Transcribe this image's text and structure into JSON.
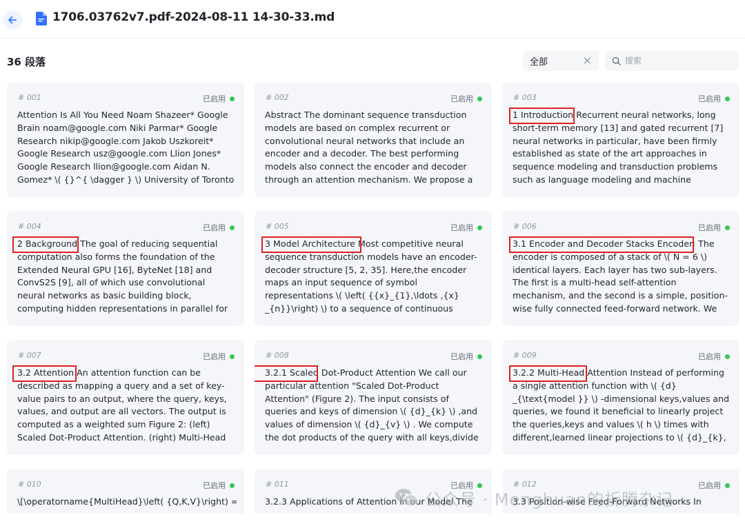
{
  "header": {
    "title": "1706.03762v7.pdf-2024-08-11 14-30-33.md"
  },
  "toolbar": {
    "count_label": "36 段落",
    "filter_label": "全部",
    "search_placeholder": "搜索"
  },
  "cards": [
    {
      "id": "# 001",
      "status": "已启用",
      "lines": [
        "Attention Is All You Need Noam Shazeer* Google",
        "Brain noam@google.com Niki Parmar* Google",
        "Research nikip@google.com Jakob Uszkoreit*",
        "Google Research usz@google.com Llion Jones*",
        "Google Research llion@google.com Aidan N.",
        "Gomez* \\( {}^{ \\dagger } \\) University of Toronto"
      ]
    },
    {
      "id": "# 002",
      "status": "已启用",
      "lines": [
        "Abstract The dominant sequence transduction",
        "models are based on complex recurrent or",
        "convolutional neural networks that include an",
        "encoder and a decoder. The best performing",
        "models also connect the encoder and decoder",
        "through an attention mechanism. We propose a"
      ]
    },
    {
      "id": "# 003",
      "status": "已启用",
      "lines": [
        "1 Introduction Recurrent neural networks, long",
        "short-term memory [13] and gated recurrent [7]",
        "neural networks in particular, have been firmly",
        "established as state of the art approaches in",
        "sequence modeling and transduction problems",
        "such as language modeling and machine"
      ]
    },
    {
      "id": "# 004",
      "status": "已启用",
      "lines": [
        "2 Background The goal of reducing sequential",
        "computation also forms the foundation of the",
        "Extended Neural GPU [16], ByteNet [18] and",
        "ConvS2S [9], all of which use convolutional",
        "neural networks as basic building block,",
        "computing hidden representations in parallel for"
      ]
    },
    {
      "id": "# 005",
      "status": "已启用",
      "lines": [
        "3 Model Architecture Most competitive neural",
        "sequence transduction models have an encoder-",
        "decoder structure [5, 2, 35]. Here,the encoder",
        "maps an input sequence of symbol",
        "representations \\( \\left( {{x}_{1},\\ldots ,{x}",
        "_{n}}\\right) \\) to a sequence of continuous"
      ]
    },
    {
      "id": "# 006",
      "status": "已启用",
      "lines": [
        "3.1 Encoder and Decoder Stacks Encoder: The",
        "encoder is composed of a stack of \\( N = 6 \\)",
        "identical layers. Each layer has two sub-layers.",
        "The first is a multi-head self-attention",
        "mechanism, and the second is a simple, position-",
        "wise fully connected feed-forward network. We"
      ]
    },
    {
      "id": "# 007",
      "status": "已启用",
      "lines": [
        "3.2 Attention An attention function can be",
        "described as mapping a query and a set of key-",
        "value pairs to an output, where the query, keys,",
        "values, and output are all vectors. The output is",
        "computed as a weighted sum Figure 2: (left)",
        "Scaled Dot-Product Attention. (right) Multi-Head"
      ]
    },
    {
      "id": "# 008",
      "status": "已启用",
      "lines": [
        "3.2.1 Scaled Dot-Product Attention We call our",
        "particular attention \"Scaled Dot-Product",
        "Attention\" (Figure 2). The input consists of",
        "queries and keys of dimension \\( {d}_{k} \\) ,and",
        "values of dimension \\( {d}_{v} \\) . We compute",
        "the dot products of the query with all keys,divide"
      ]
    },
    {
      "id": "# 009",
      "status": "已启用",
      "lines": [
        "3.2.2 Multi-Head Attention Instead of performing",
        "a single attention function with \\( {d}",
        "_{\\text{model }} \\) -dimensional keys,values and",
        "queries, we found it beneficial to linearly project",
        "the queries,keys and values \\( h \\) times with",
        "different,learned linear projections to \\( {d}_{k},"
      ]
    },
    {
      "id": "# 010",
      "status": "已启用",
      "lines": [
        "\\[\\operatorname{MultiHead}\\left( {Q,K,V}\\right) ="
      ]
    },
    {
      "id": "# 011",
      "status": "已启用",
      "lines": [
        "3.2.3 Applications of Attention in our Model The"
      ]
    },
    {
      "id": "# 012",
      "status": "已启用",
      "lines": [
        "3.3 Position-wise Feed-Forward Networks In"
      ]
    }
  ],
  "watermark": {
    "text": "公众号 · Menghuan的折腾杂记"
  },
  "colors": {
    "accent": "#3370ff",
    "status_green": "#34c759",
    "highlight_red": "#e02020"
  }
}
